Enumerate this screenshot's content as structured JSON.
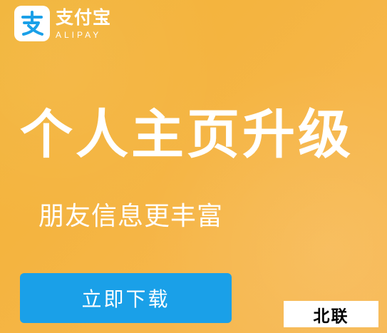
{
  "brand": {
    "name_cn": "支付宝",
    "name_en": "ALIPAY",
    "logo_glyph": "支",
    "logo_icon": "alipay-logo-icon"
  },
  "hero": {
    "headline": "个人主页升级",
    "subheadline": "朋友信息更丰富"
  },
  "cta": {
    "download_label": "立即下载"
  },
  "watermark": {
    "text": "北联"
  },
  "colors": {
    "background": "#f4b43f",
    "button": "#1aa0e8",
    "text": "#ffffff",
    "logo_blue": "#1aa0e8"
  }
}
